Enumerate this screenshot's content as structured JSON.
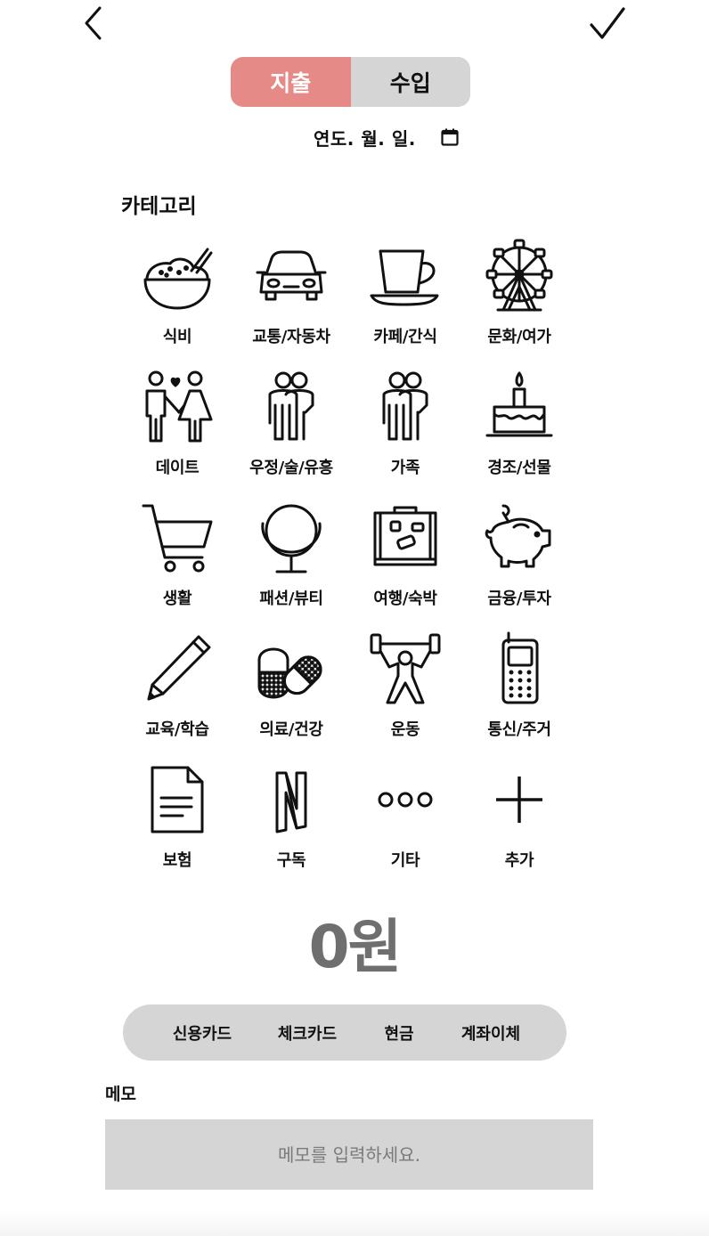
{
  "header": {
    "back_icon": "chevron-left-icon",
    "confirm_icon": "check-icon"
  },
  "type_toggle": {
    "expense_label": "지출",
    "income_label": "수입",
    "selected": "지출",
    "active_color": "#e58a86",
    "inactive_color": "#d5d5d5"
  },
  "date": {
    "text": "연도. 월. 일.",
    "icon": "calendar-icon"
  },
  "category": {
    "title": "카테고리",
    "items": [
      {
        "label": "식비",
        "icon": "rice-bowl-icon"
      },
      {
        "label": "교통/자동차",
        "icon": "car-icon"
      },
      {
        "label": "카페/간식",
        "icon": "coffee-cup-icon"
      },
      {
        "label": "문화/여가",
        "icon": "ferris-wheel-icon"
      },
      {
        "label": "데이트",
        "icon": "couple-icon"
      },
      {
        "label": "우정/술/유흥",
        "icon": "friends-icon"
      },
      {
        "label": "가족",
        "icon": "family-icon"
      },
      {
        "label": "경조/선물",
        "icon": "cake-icon"
      },
      {
        "label": "생활",
        "icon": "shopping-cart-icon"
      },
      {
        "label": "패션/뷰티",
        "icon": "mirror-icon"
      },
      {
        "label": "여행/숙박",
        "icon": "suitcase-icon"
      },
      {
        "label": "금융/투자",
        "icon": "piggy-bank-icon"
      },
      {
        "label": "교육/학습",
        "icon": "pencil-icon"
      },
      {
        "label": "의료/건강",
        "icon": "pill-icon"
      },
      {
        "label": "운동",
        "icon": "weightlifter-icon"
      },
      {
        "label": "통신/주거",
        "icon": "mobile-phone-icon"
      },
      {
        "label": "보험",
        "icon": "document-icon"
      },
      {
        "label": "구독",
        "icon": "netflix-icon"
      },
      {
        "label": "기타",
        "icon": "more-icon"
      },
      {
        "label": "추가",
        "icon": "plus-icon"
      }
    ]
  },
  "amount": {
    "text": "0원"
  },
  "payment_methods": [
    "신용카드",
    "체크카드",
    "현금",
    "계좌이체"
  ],
  "memo": {
    "label": "메모",
    "placeholder": "메모를 입력하세요."
  }
}
